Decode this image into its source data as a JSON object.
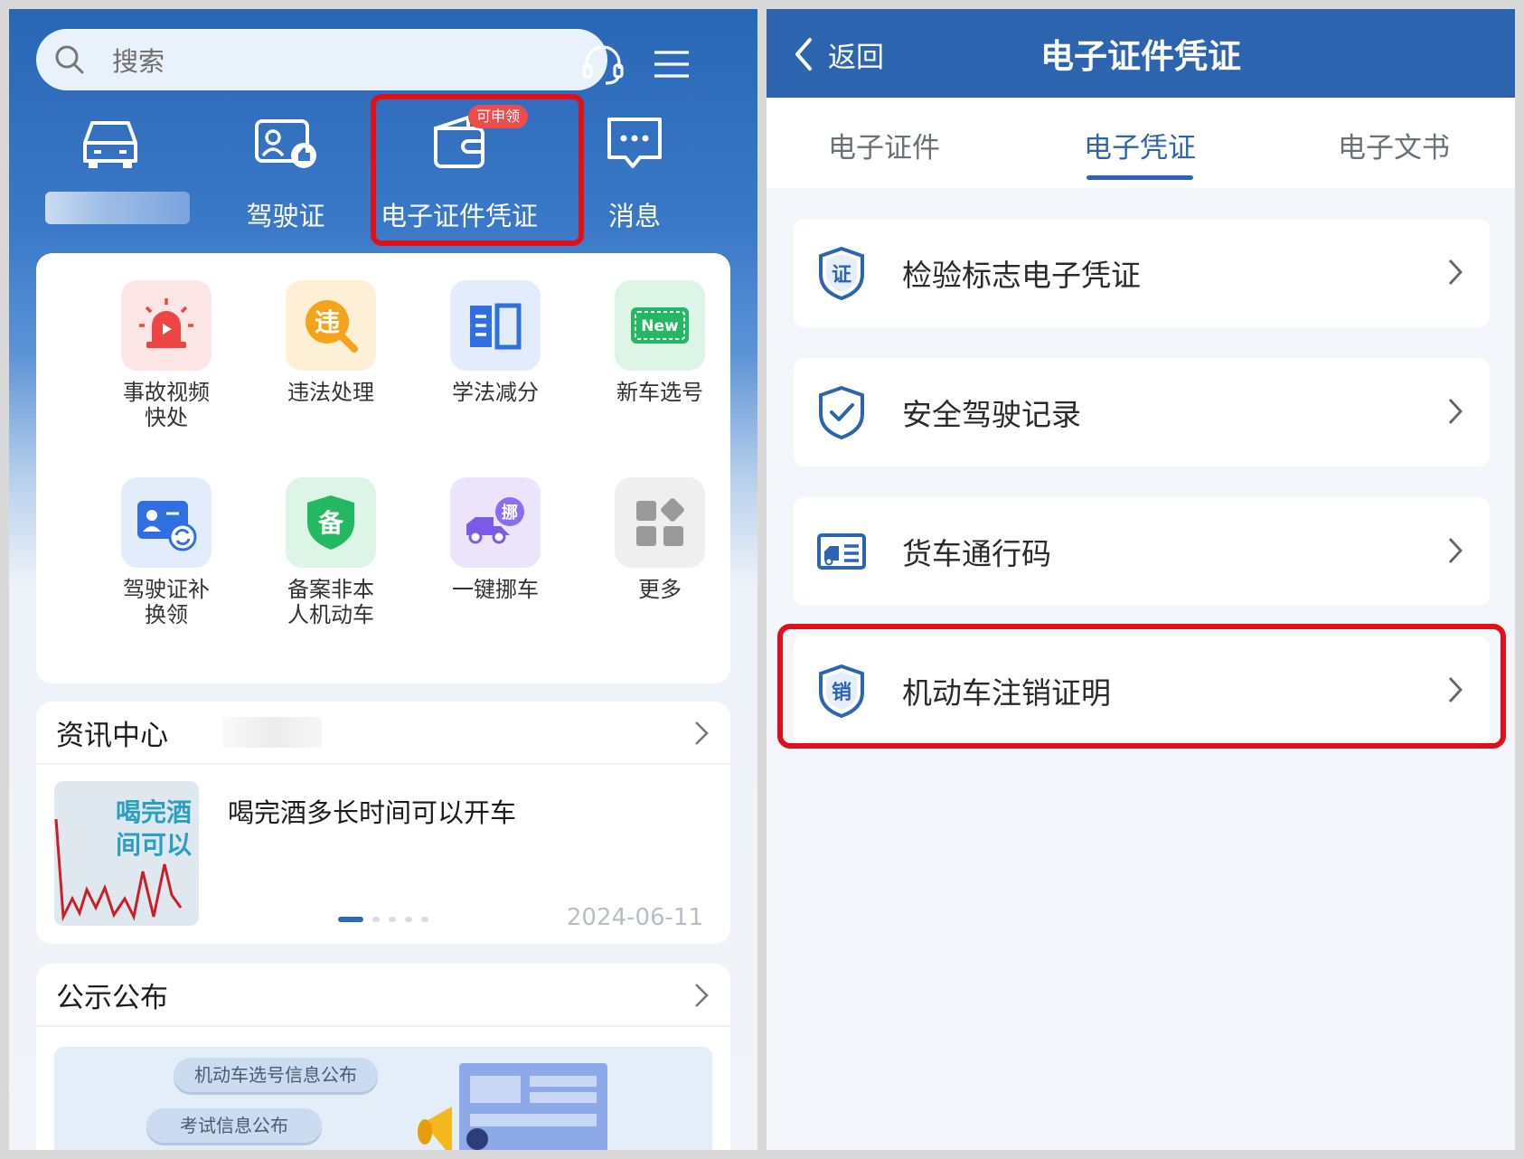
{
  "left": {
    "search": {
      "placeholder": "搜索"
    },
    "top_icons": [
      "headset-icon",
      "menu-icon"
    ],
    "quick": [
      {
        "icon": "car-icon",
        "label": ""
      },
      {
        "icon": "license-thumb-icon",
        "label": "驾驶证"
      },
      {
        "icon": "wallet-icon",
        "label": "电子证件凭证",
        "badge": "可申领"
      },
      {
        "icon": "message-icon",
        "label": "消息"
      }
    ],
    "services": [
      {
        "icon": "alarm-icon",
        "label": "事故视频\n快处"
      },
      {
        "icon": "violation-icon",
        "label": "违法处理"
      },
      {
        "icon": "book-icon",
        "label": "学法减分"
      },
      {
        "icon": "new-plate-icon",
        "label": "新车选号"
      },
      {
        "icon": "id-swap-icon",
        "label": "驾驶证补\n换领"
      },
      {
        "icon": "shield-record-icon",
        "label": "备案非本\n人机动车"
      },
      {
        "icon": "tow-truck-icon",
        "label": "一键挪车"
      },
      {
        "icon": "more-grid-icon",
        "label": "更多"
      }
    ],
    "service_icon_text": {
      "violation": "违",
      "new": "New",
      "record": "备",
      "tow": "挪"
    },
    "news": {
      "title": "资讯中心",
      "item_title": "喝完酒多长时间可以开车",
      "date": "2024-06-11",
      "thumb_text": [
        "喝完酒",
        "间可以"
      ],
      "dots": 5,
      "active_dot": 0
    },
    "publication": {
      "title": "公示公布",
      "pills": [
        "机动车选号信息公布",
        "考试信息公布"
      ]
    }
  },
  "right": {
    "back": "返回",
    "title": "电子证件凭证",
    "tabs": [
      "电子证件",
      "电子凭证",
      "电子文书"
    ],
    "active_tab": 1,
    "items": [
      {
        "icon": "cert-shield-icon",
        "icon_text": "证",
        "label": "检验标志电子凭证"
      },
      {
        "icon": "check-shield-icon",
        "icon_text": "",
        "label": "安全驾驶记录"
      },
      {
        "icon": "truck-pass-icon",
        "icon_text": "",
        "label": "货车通行码"
      },
      {
        "icon": "cancel-shield-icon",
        "icon_text": "销",
        "label": "机动车注销证明"
      }
    ]
  },
  "colors": {
    "brand_blue": "#2d64b0",
    "highlight_red": "#e0101a",
    "badge_red": "#ee4b4b"
  }
}
